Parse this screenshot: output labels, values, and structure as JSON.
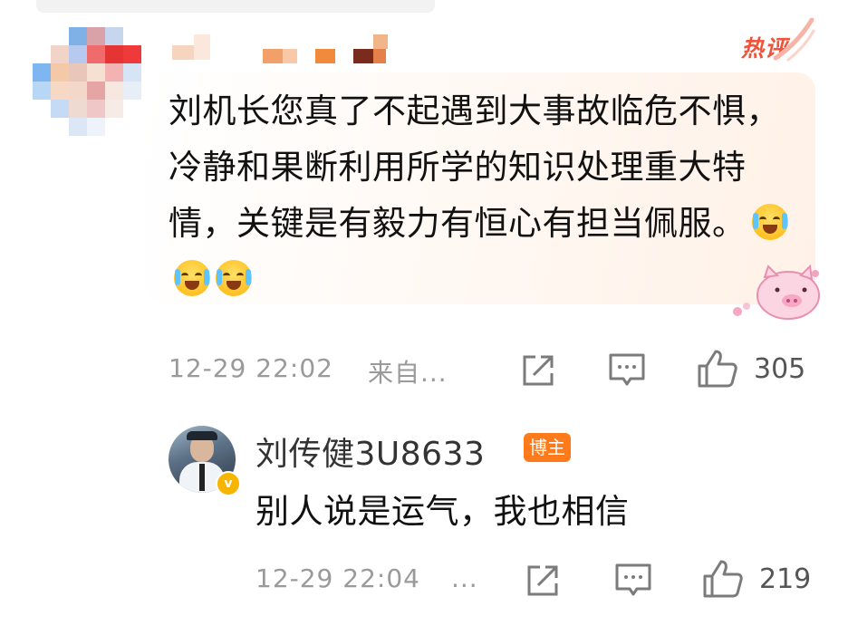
{
  "comment": {
    "hot_badge": "热评",
    "text": "刘机长您真了不起遇到大事故临危不惧，冷静和果断利用所学的知识处理重大特情，关键是有毅力有恒心有担当佩服。",
    "emoji_icons": [
      "laughing-tears-emoji",
      "laughing-tears-emoji",
      "laughing-tears-emoji"
    ],
    "timestamp": "12-29 22:02",
    "source": "来自...",
    "like_count": "305",
    "icons": [
      "share-icon",
      "comment-icon",
      "like-icon"
    ]
  },
  "reply": {
    "author": "刘传健3U8633",
    "badge": "博主",
    "text": "别人说是运气，我也相信",
    "timestamp": "12-29 22:04",
    "more": "...",
    "like_count": "219",
    "icons": [
      "share-icon",
      "comment-icon",
      "like-icon"
    ]
  },
  "colors": {
    "accent": "#f0523a",
    "badge_orange": "#ff7a1a",
    "meta_gray": "#9a9a9a",
    "verified_gold": "#f7b500"
  }
}
